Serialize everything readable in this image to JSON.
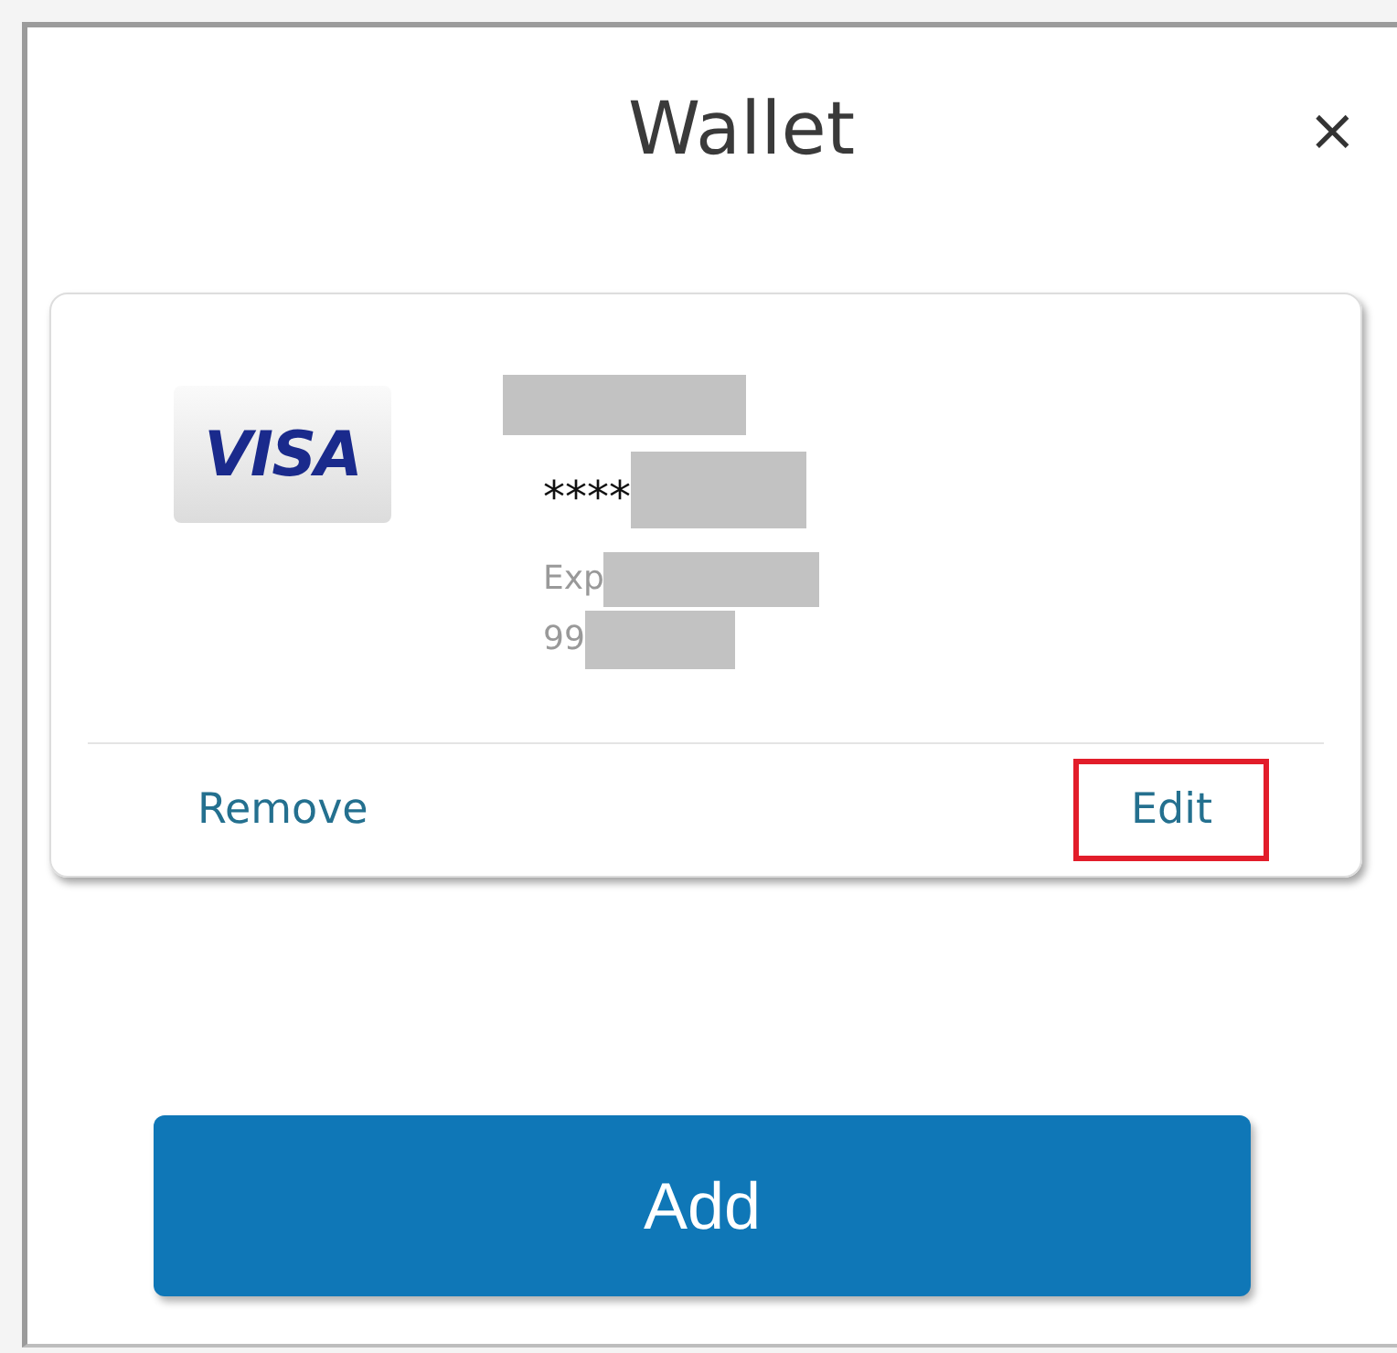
{
  "dialog": {
    "title": "Wallet",
    "close": "×"
  },
  "card": {
    "brand": "VISA",
    "number_prefix": "****",
    "expiry_label": "Exp",
    "expiry_value": "99",
    "actions": [
      {
        "label": "Remove",
        "highlighted": false
      },
      {
        "label": "Edit",
        "highlighted": true
      }
    ]
  },
  "add_button": "Add"
}
